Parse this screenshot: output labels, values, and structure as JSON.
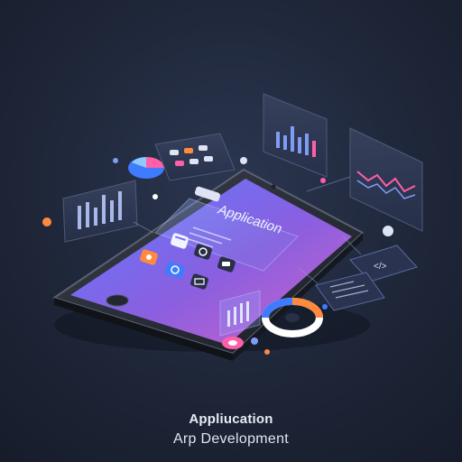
{
  "phone": {
    "screen_heading": "Application"
  },
  "code_card": {
    "symbol": "</>"
  },
  "caption": {
    "title": "Appliucation",
    "subtitle": "Arp Development"
  },
  "colors": {
    "background": "#1e2638",
    "accent_blue": "#3f7bff",
    "accent_pink": "#ff5ea8",
    "accent_purple": "#8a6cff",
    "screen_top": "#6f6cff",
    "screen_bottom": "#c05fd0"
  },
  "icons": [
    "calendar-icon",
    "target-icon",
    "chat-icon",
    "phone-icon",
    "camera-icon",
    "mail-icon",
    "pie-chart-icon",
    "bar-chart-icon",
    "line-chart-icon",
    "code-icon",
    "donut-chart-icon"
  ]
}
